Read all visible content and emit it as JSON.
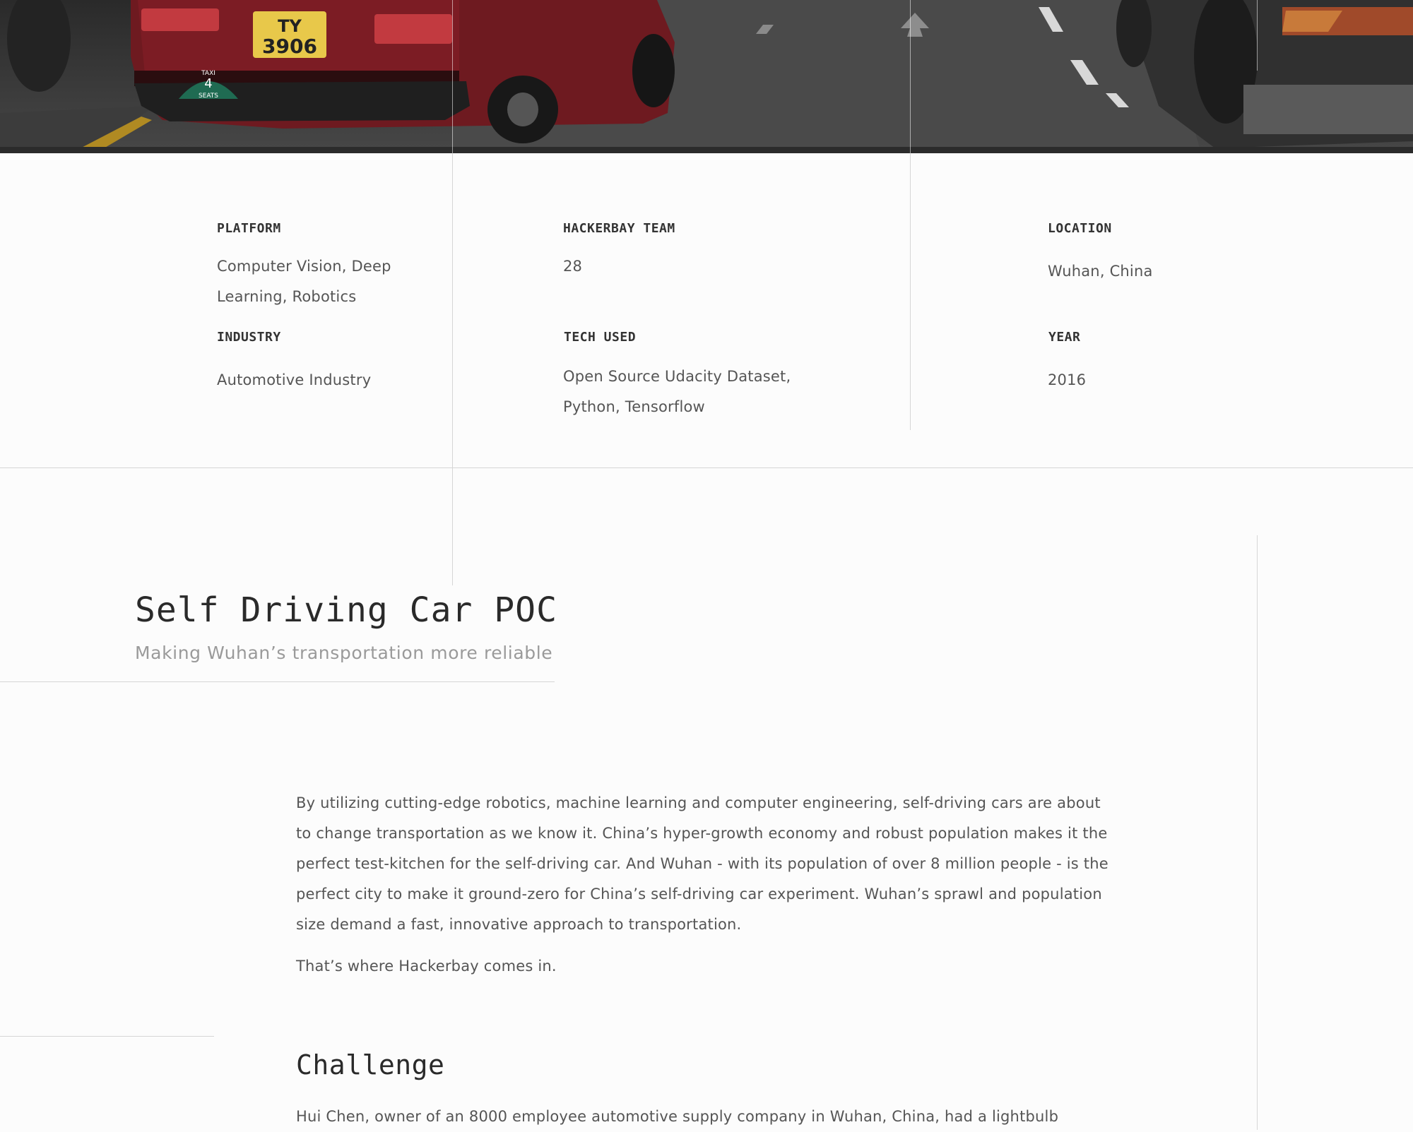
{
  "hero": {
    "plate_line1": "TY",
    "plate_line2": "3906",
    "sign_top": "TAXI",
    "sign_mid": "4",
    "sign_bottom": "SEATS"
  },
  "info": {
    "platform": {
      "label": "PLATFORM",
      "value": "Computer Vision, Deep Learning, Robotics"
    },
    "team": {
      "label": "HACKERBAY TEAM",
      "value": "28"
    },
    "location": {
      "label": "LOCATION",
      "value": "Wuhan, China"
    },
    "industry": {
      "label": "INDUSTRY",
      "value": "Automotive Industry"
    },
    "tech": {
      "label": "TECH USED",
      "value": "Open Source Udacity Dataset, Python, Tensorflow"
    },
    "year": {
      "label": "YEAR",
      "value": "2016"
    }
  },
  "project": {
    "title": "Self Driving Car POC",
    "subtitle": "Making Wuhan’s transportation more reliable"
  },
  "body": {
    "intro": "By utilizing cutting-edge robotics, machine learning and computer engineering, self-driving cars are about to change transportation as we know it.  China’s hyper-growth economy and robust population makes it the perfect test-kitchen for the self-driving car.  And Wuhan - with its population of over 8 million people - is the perfect city to make it ground-zero for China’s self-driving car experiment. Wuhan’s sprawl and population size demand a fast, innovative approach to transportation.",
    "outro": "That’s where Hackerbay comes in."
  },
  "challenge": {
    "heading": "Challenge",
    "text": "Hui Chen, owner of an 8000 employee automotive supply company in Wuhan, China, had a lightbulb"
  }
}
